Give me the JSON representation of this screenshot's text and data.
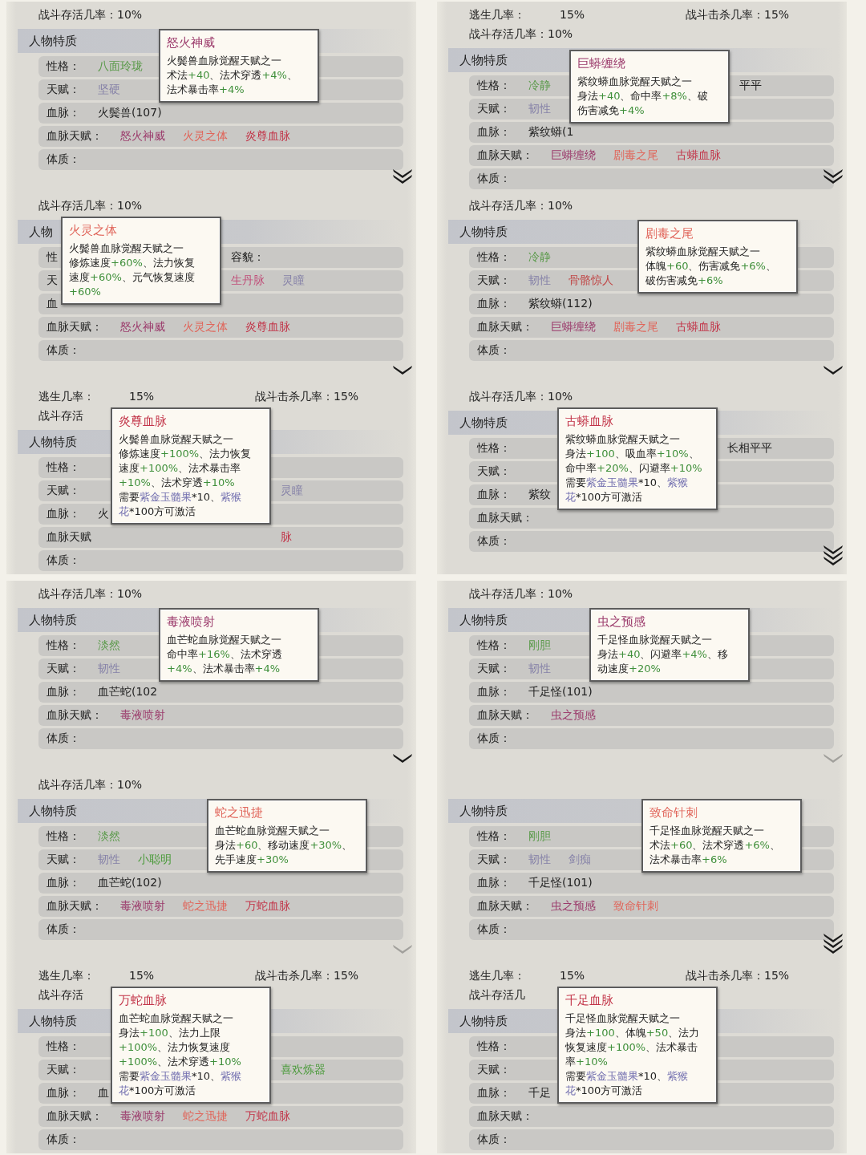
{
  "panels": [
    {
      "stat_lines": [
        [
          "战斗存活几率：10%"
        ]
      ],
      "section": "人物特质",
      "expand_icon": {
        "kind": "double"
      },
      "rows": [
        {
          "label": "性格：",
          "values": [
            {
              "text": "八面玲珑",
              "color": "#5a9a4a"
            }
          ]
        },
        {
          "label": "天赋：",
          "values": [
            {
              "text": "坚硬",
              "color": "#8682a8"
            }
          ]
        },
        {
          "label": "血脉：",
          "values": [
            {
              "text": "火鬓兽(107)",
              "color": "#222222"
            }
          ]
        },
        {
          "label": "血脉天赋：",
          "values": [
            {
              "text": "怒火神威",
              "color": "#9b3a6b"
            },
            {
              "text": "火灵之体",
              "color": "#e0655a"
            },
            {
              "text": "炎尊血脉",
              "color": "#c23448"
            }
          ]
        },
        {
          "label": "体质：",
          "values": []
        }
      ],
      "popup": {
        "title": "怒火神威",
        "color": "#9b3a6b",
        "lines": [
          [
            {
              "text": "火鬓兽血脉觉醒天赋之一",
              "kind": "plain"
            }
          ],
          [
            {
              "text": "术法",
              "kind": "plain"
            },
            {
              "text": "+40",
              "kind": "bonus"
            },
            {
              "text": "、法术穿透",
              "kind": "plain"
            },
            {
              "text": "+4%",
              "kind": "bonus"
            },
            {
              "text": "、",
              "kind": "plain"
            }
          ],
          [
            {
              "text": "法术暴击率",
              "kind": "plain"
            },
            {
              "text": "+4%",
              "kind": "bonus"
            }
          ]
        ]
      }
    },
    {
      "stat_lines": [
        [
          "战斗存活几率：10%"
        ]
      ],
      "section": "人物",
      "expand_icon": {
        "kind": "single"
      },
      "rows": [
        {
          "label": "性",
          "values": [],
          "beyond": [
            {
              "text": "容貌：",
              "color": "#222222"
            }
          ]
        },
        {
          "label": "天",
          "values": [],
          "beyond": [
            {
              "text": "生丹脉",
              "color": "#c0507a"
            },
            {
              "text": "灵瞳",
              "color": "#8682a8"
            }
          ]
        },
        {
          "label": "血",
          "values": []
        },
        {
          "label": "血脉天赋：",
          "values": [
            {
              "text": "怒火神威",
              "color": "#9b3a6b"
            },
            {
              "text": "火灵之体",
              "color": "#e0655a"
            },
            {
              "text": "炎尊血脉",
              "color": "#c23448"
            }
          ]
        },
        {
          "label": "体质：",
          "values": []
        }
      ],
      "popup": {
        "title": "火灵之体",
        "color": "#e0655a",
        "lines": [
          [
            {
              "text": "火鬓兽血脉觉醒天赋之一",
              "kind": "plain"
            }
          ],
          [
            {
              "text": "修炼速度",
              "kind": "plain"
            },
            {
              "text": "+60%",
              "kind": "bonus"
            },
            {
              "text": "、法力恢复",
              "kind": "plain"
            }
          ],
          [
            {
              "text": "速度",
              "kind": "plain"
            },
            {
              "text": "+60%",
              "kind": "bonus"
            },
            {
              "text": "、元气恢复速度",
              "kind": "plain"
            }
          ],
          [
            {
              "text": "+60%",
              "kind": "bonus"
            }
          ]
        ]
      }
    },
    {
      "stat_lines": [
        [
          "逃生几率：",
          "15%",
          "战斗击杀几率：15%"
        ],
        [
          "战斗存活"
        ]
      ],
      "section": "人物特质",
      "rows": [
        {
          "label": "性格：",
          "values": []
        },
        {
          "label": "天赋：",
          "values": [],
          "beyond": [
            {
              "text": "灵瞳",
              "color": "#8682a8"
            }
          ]
        },
        {
          "label": "血脉：",
          "values": [
            {
              "text": "火",
              "color": "#222222"
            }
          ]
        },
        {
          "label": "血脉天赋",
          "values": [],
          "beyond": [
            {
              "text": "脉",
              "color": "#c23448"
            }
          ]
        },
        {
          "label": "体质：",
          "values": []
        }
      ],
      "popup": {
        "title": "炎尊血脉",
        "color": "#c23448",
        "lines": [
          [
            {
              "text": "火鬓兽血脉觉醒天赋之一",
              "kind": "plain"
            }
          ],
          [
            {
              "text": "修炼速度",
              "kind": "plain"
            },
            {
              "text": "+100%",
              "kind": "bonus"
            },
            {
              "text": "、法力恢复",
              "kind": "plain"
            }
          ],
          [
            {
              "text": "速度",
              "kind": "plain"
            },
            {
              "text": "+100%",
              "kind": "bonus"
            },
            {
              "text": "、法术暴击率",
              "kind": "plain"
            }
          ],
          [
            {
              "text": "+10%",
              "kind": "bonus"
            },
            {
              "text": "、法术穿透",
              "kind": "plain"
            },
            {
              "text": "+10%",
              "kind": "bonus"
            }
          ],
          [
            {
              "text": "需要",
              "kind": "plain"
            },
            {
              "text": "紫金玉髓果",
              "kind": "item"
            },
            {
              "text": "*10、",
              "kind": "plain"
            },
            {
              "text": "紫猴",
              "kind": "item"
            }
          ],
          [
            {
              "text": "花",
              "kind": "item"
            },
            {
              "text": "*100方可激活",
              "kind": "plain"
            }
          ]
        ]
      }
    },
    {
      "stat_lines": [
        [
          "战斗存活几率：10%"
        ]
      ],
      "section": "人物特质",
      "expand_icon": {
        "kind": "single"
      },
      "rows": [
        {
          "label": "性格：",
          "values": [
            {
              "text": "淡然",
              "color": "#5a9a4a"
            }
          ]
        },
        {
          "label": "天赋：",
          "values": [
            {
              "text": "韧性",
              "color": "#8682a8"
            }
          ]
        },
        {
          "label": "血脉：",
          "values": [
            {
              "text": "血芒蛇(102",
              "color": "#222222"
            }
          ]
        },
        {
          "label": "血脉天赋：",
          "values": [
            {
              "text": "毒液喷射",
              "color": "#9b3a6b"
            }
          ]
        },
        {
          "label": "体质：",
          "values": []
        }
      ],
      "popup": {
        "title": "毒液喷射",
        "color": "#9b3a6b",
        "lines": [
          [
            {
              "text": "血芒蛇血脉觉醒天赋之一",
              "kind": "plain"
            }
          ],
          [
            {
              "text": "命中率",
              "kind": "plain"
            },
            {
              "text": "+16%",
              "kind": "bonus"
            },
            {
              "text": "、法术穿透",
              "kind": "plain"
            }
          ],
          [
            {
              "text": "+4%",
              "kind": "bonus"
            },
            {
              "text": "、法术暴击率",
              "kind": "plain"
            },
            {
              "text": "+4%",
              "kind": "bonus"
            }
          ]
        ]
      }
    },
    {
      "stat_lines": [
        [
          "战斗存活几率：10%"
        ]
      ],
      "section": "人物特质",
      "expand_icon": {
        "kind": "faded"
      },
      "rows": [
        {
          "label": "性格：",
          "values": [
            {
              "text": "淡然",
              "color": "#5a9a4a"
            }
          ]
        },
        {
          "label": "天赋：",
          "values": [
            {
              "text": "韧性",
              "color": "#8682a8"
            },
            {
              "text": "小聪明",
              "color": "#4a9a3a"
            }
          ]
        },
        {
          "label": "血脉：",
          "values": [
            {
              "text": "血芒蛇(102)",
              "color": "#222222"
            }
          ]
        },
        {
          "label": "血脉天赋：",
          "values": [
            {
              "text": "毒液喷射",
              "color": "#9b3a6b"
            },
            {
              "text": "蛇之迅捷",
              "color": "#e0655a"
            },
            {
              "text": "万蛇血脉",
              "color": "#c23448"
            }
          ]
        },
        {
          "label": "体质：",
          "values": []
        }
      ],
      "popup": {
        "title": "蛇之迅捷",
        "color": "#e0655a",
        "lines": [
          [
            {
              "text": "血芒蛇血脉觉醒天赋之一",
              "kind": "plain"
            }
          ],
          [
            {
              "text": "身法",
              "kind": "plain"
            },
            {
              "text": "+60",
              "kind": "bonus"
            },
            {
              "text": "、移动速度",
              "kind": "plain"
            },
            {
              "text": "+30%",
              "kind": "bonus"
            },
            {
              "text": "、",
              "kind": "plain"
            }
          ],
          [
            {
              "text": "先手速度",
              "kind": "plain"
            },
            {
              "text": "+30%",
              "kind": "bonus"
            }
          ]
        ]
      }
    },
    {
      "stat_lines": [
        [
          "逃生几率：",
          "15%",
          "战斗击杀几率：15%"
        ],
        [
          "战斗存活"
        ]
      ],
      "section": "人物特质",
      "rows": [
        {
          "label": "性格：",
          "values": []
        },
        {
          "label": "天赋：",
          "values": [],
          "beyond": [
            {
              "text": "喜欢炼器",
              "color": "#4a9a3a"
            }
          ]
        },
        {
          "label": "血脉：",
          "values": [
            {
              "text": "血",
              "color": "#222222"
            }
          ]
        },
        {
          "label": "血脉天赋：",
          "values": [
            {
              "text": "毒液喷射",
              "color": "#9b3a6b"
            },
            {
              "text": "蛇之迅捷",
              "color": "#e0655a"
            },
            {
              "text": "万蛇血脉",
              "color": "#c23448"
            }
          ]
        },
        {
          "label": "体质：",
          "values": []
        }
      ],
      "popup": {
        "title": "万蛇血脉",
        "color": "#c23448",
        "lines": [
          [
            {
              "text": "血芒蛇血脉觉醒天赋之一",
              "kind": "plain"
            }
          ],
          [
            {
              "text": "身法",
              "kind": "plain"
            },
            {
              "text": "+100",
              "kind": "bonus"
            },
            {
              "text": "、法力上限",
              "kind": "plain"
            }
          ],
          [
            {
              "text": "+100%",
              "kind": "bonus"
            },
            {
              "text": "、法力恢复速度",
              "kind": "plain"
            }
          ],
          [
            {
              "text": "+100%",
              "kind": "bonus"
            },
            {
              "text": "、法术穿透",
              "kind": "plain"
            },
            {
              "text": "+10%",
              "kind": "bonus"
            }
          ],
          [
            {
              "text": "需要",
              "kind": "plain"
            },
            {
              "text": "紫金玉髓果",
              "kind": "item"
            },
            {
              "text": "*10、",
              "kind": "plain"
            },
            {
              "text": "紫猴",
              "kind": "item"
            }
          ],
          [
            {
              "text": "花",
              "kind": "item"
            },
            {
              "text": "*100方可激活",
              "kind": "plain"
            }
          ]
        ]
      }
    },
    {
      "stat_lines": [
        [
          "逃生几率：",
          "15%",
          "战斗击杀几率：15%"
        ],
        [
          "战斗存活几率：10%"
        ]
      ],
      "section": "人物特质",
      "expand_icon": {
        "kind": "double"
      },
      "rows": [
        {
          "label": "性格：",
          "values": [
            {
              "text": "冷静",
              "color": "#5a9a4a"
            }
          ],
          "beyond": [
            {
              "text": "平平",
              "color": "#222222"
            }
          ]
        },
        {
          "label": "天赋：",
          "values": [
            {
              "text": "韧性",
              "color": "#8682a8"
            }
          ]
        },
        {
          "label": "血脉：",
          "values": [
            {
              "text": "紫纹蟒(1",
              "color": "#222222"
            }
          ]
        },
        {
          "label": "血脉天赋：",
          "values": [
            {
              "text": "巨蟒缠绕",
              "color": "#9b3a6b"
            },
            {
              "text": "剧毒之尾",
              "color": "#e0655a"
            },
            {
              "text": "古蟒血脉",
              "color": "#c23448"
            }
          ]
        },
        {
          "label": "体质：",
          "values": []
        }
      ],
      "popup": {
        "title": "巨蟒缠绕",
        "color": "#9b3a6b",
        "lines": [
          [
            {
              "text": "紫纹蟒血脉觉醒天赋之一",
              "kind": "plain"
            }
          ],
          [
            {
              "text": "身法",
              "kind": "plain"
            },
            {
              "text": "+40",
              "kind": "bonus"
            },
            {
              "text": "、命中率",
              "kind": "plain"
            },
            {
              "text": "+8%",
              "kind": "bonus"
            },
            {
              "text": "、破",
              "kind": "plain"
            }
          ],
          [
            {
              "text": "伤害减免",
              "kind": "plain"
            },
            {
              "text": "+4%",
              "kind": "bonus"
            }
          ]
        ]
      }
    },
    {
      "stat_lines": [
        [
          "战斗存活几率：10%"
        ]
      ],
      "section": "人物特质",
      "expand_icon": {
        "kind": "single"
      },
      "rows": [
        {
          "label": "性格：",
          "values": [
            {
              "text": "冷静",
              "color": "#5a9a4a"
            }
          ]
        },
        {
          "label": "天赋：",
          "values": [
            {
              "text": "韧性",
              "color": "#8682a8"
            },
            {
              "text": "骨骼惊人",
              "color": "#c04848"
            }
          ]
        },
        {
          "label": "血脉：",
          "values": [
            {
              "text": "紫纹蟒(112)",
              "color": "#222222"
            }
          ]
        },
        {
          "label": "血脉天赋：",
          "values": [
            {
              "text": "巨蟒缠绕",
              "color": "#9b3a6b"
            },
            {
              "text": "剧毒之尾",
              "color": "#e0655a"
            },
            {
              "text": "古蟒血脉",
              "color": "#c23448"
            }
          ]
        },
        {
          "label": "体质：",
          "values": []
        }
      ],
      "popup": {
        "title": "剧毒之尾",
        "color": "#e0655a",
        "lines": [
          [
            {
              "text": "紫纹蟒血脉觉醒天赋之一",
              "kind": "plain"
            }
          ],
          [
            {
              "text": "体魄",
              "kind": "plain"
            },
            {
              "text": "+60",
              "kind": "bonus"
            },
            {
              "text": "、伤害减免",
              "kind": "plain"
            },
            {
              "text": "+6%",
              "kind": "bonus"
            },
            {
              "text": "、",
              "kind": "plain"
            }
          ],
          [
            {
              "text": "破伤害减免",
              "kind": "plain"
            },
            {
              "text": "+6%",
              "kind": "bonus"
            }
          ]
        ]
      }
    },
    {
      "stat_lines": [
        [
          "战斗存活几率：10%"
        ]
      ],
      "section": "人物特质",
      "expand_icon": {
        "kind": "triple"
      },
      "rows": [
        {
          "label": "性格：",
          "values": [],
          "beyond": [
            {
              "text": "长相平平",
              "color": "#222222"
            }
          ]
        },
        {
          "label": "天赋：",
          "values": []
        },
        {
          "label": "血脉：",
          "values": [
            {
              "text": "紫纹",
              "color": "#222222"
            }
          ]
        },
        {
          "label": "血脉天赋：",
          "values": []
        },
        {
          "label": "体质：",
          "values": []
        }
      ],
      "popup": {
        "title": "古蟒血脉",
        "color": "#c23448",
        "lines": [
          [
            {
              "text": "紫纹蟒血脉觉醒天赋之一",
              "kind": "plain"
            }
          ],
          [
            {
              "text": "身法",
              "kind": "plain"
            },
            {
              "text": "+100",
              "kind": "bonus"
            },
            {
              "text": "、吸血率",
              "kind": "plain"
            },
            {
              "text": "+10%",
              "kind": "bonus"
            },
            {
              "text": "、",
              "kind": "plain"
            }
          ],
          [
            {
              "text": "命中率",
              "kind": "plain"
            },
            {
              "text": "+20%",
              "kind": "bonus"
            },
            {
              "text": "、闪避率",
              "kind": "plain"
            },
            {
              "text": "+10%",
              "kind": "bonus"
            }
          ],
          [
            {
              "text": "需要",
              "kind": "plain"
            },
            {
              "text": "紫金玉髓果",
              "kind": "item"
            },
            {
              "text": "*10、",
              "kind": "plain"
            },
            {
              "text": "紫猴",
              "kind": "item"
            }
          ],
          [
            {
              "text": "花",
              "kind": "item"
            },
            {
              "text": "*100方可激活",
              "kind": "plain"
            }
          ]
        ]
      }
    },
    {
      "stat_lines": [
        [
          "战斗存活几率：10%"
        ]
      ],
      "section": "人物特质",
      "expand_icon": {
        "kind": "faded"
      },
      "rows": [
        {
          "label": "性格：",
          "values": [
            {
              "text": "刚胆",
              "color": "#5a9a4a"
            }
          ]
        },
        {
          "label": "天赋：",
          "values": [
            {
              "text": "韧性",
              "color": "#8682a8"
            }
          ]
        },
        {
          "label": "血脉：",
          "values": [
            {
              "text": "千足怪(101)",
              "color": "#222222"
            }
          ]
        },
        {
          "label": "血脉天赋：",
          "values": [
            {
              "text": "虫之预感",
              "color": "#9b3a6b"
            }
          ]
        },
        {
          "label": "体质：",
          "values": []
        }
      ],
      "popup": {
        "title": "虫之预感",
        "color": "#9b3a6b",
        "lines": [
          [
            {
              "text": "千足怪血脉觉醒天赋之一",
              "kind": "plain"
            }
          ],
          [
            {
              "text": "身法",
              "kind": "plain"
            },
            {
              "text": "+40",
              "kind": "bonus"
            },
            {
              "text": "、闪避率",
              "kind": "plain"
            },
            {
              "text": "+4%",
              "kind": "bonus"
            },
            {
              "text": "、移",
              "kind": "plain"
            }
          ],
          [
            {
              "text": "动速度",
              "kind": "plain"
            },
            {
              "text": "+20%",
              "kind": "bonus"
            }
          ]
        ]
      }
    },
    {
      "section": "人物特质",
      "expand_icon": {
        "kind": "triple"
      },
      "rows": [
        {
          "label": "性格：",
          "values": [
            {
              "text": "刚胆",
              "color": "#5a9a4a"
            }
          ]
        },
        {
          "label": "天赋：",
          "values": [
            {
              "text": "韧性",
              "color": "#8682a8"
            },
            {
              "text": "剑痴",
              "color": "#8682a8"
            }
          ]
        },
        {
          "label": "血脉：",
          "values": [
            {
              "text": "千足怪(101)",
              "color": "#222222"
            }
          ]
        },
        {
          "label": "血脉天赋：",
          "values": [
            {
              "text": "虫之预感",
              "color": "#9b3a6b"
            },
            {
              "text": "致命针刺",
              "color": "#e0655a"
            }
          ]
        },
        {
          "label": "体质：",
          "values": []
        }
      ],
      "popup": {
        "title": "致命针刺",
        "color": "#e0655a",
        "lines": [
          [
            {
              "text": "千足怪血脉觉醒天赋之一",
              "kind": "plain"
            }
          ],
          [
            {
              "text": "术法",
              "kind": "plain"
            },
            {
              "text": "+60",
              "kind": "bonus"
            },
            {
              "text": "、法术穿透",
              "kind": "plain"
            },
            {
              "text": "+6%",
              "kind": "bonus"
            },
            {
              "text": "、",
              "kind": "plain"
            }
          ],
          [
            {
              "text": "法术暴击率",
              "kind": "plain"
            },
            {
              "text": "+6%",
              "kind": "bonus"
            }
          ]
        ]
      }
    },
    {
      "stat_lines": [
        [
          "逃生几率：",
          "15%",
          "战斗击杀几率：15%"
        ],
        [
          "战斗存活几"
        ]
      ],
      "section": "人物特质",
      "rows": [
        {
          "label": "性格：",
          "values": []
        },
        {
          "label": "天赋：",
          "values": []
        },
        {
          "label": "血脉：",
          "values": [
            {
              "text": "千足",
              "color": "#222222"
            }
          ]
        },
        {
          "label": "血脉天赋：",
          "values": []
        },
        {
          "label": "体质：",
          "values": []
        }
      ],
      "popup": {
        "title": "千足血脉",
        "color": "#c23448",
        "lines": [
          [
            {
              "text": "千足怪血脉觉醒天赋之一",
              "kind": "plain"
            }
          ],
          [
            {
              "text": "身法",
              "kind": "plain"
            },
            {
              "text": "+100",
              "kind": "bonus"
            },
            {
              "text": "、体魄",
              "kind": "plain"
            },
            {
              "text": "+50",
              "kind": "bonus"
            },
            {
              "text": "、法力",
              "kind": "plain"
            }
          ],
          [
            {
              "text": "恢复速度",
              "kind": "plain"
            },
            {
              "text": "+100%",
              "kind": "bonus"
            },
            {
              "text": "、法术暴击",
              "kind": "plain"
            }
          ],
          [
            {
              "text": "率",
              "kind": "plain"
            },
            {
              "text": "+10%",
              "kind": "bonus"
            }
          ],
          [
            {
              "text": "需要",
              "kind": "plain"
            },
            {
              "text": "紫金玉髓果",
              "kind": "item"
            },
            {
              "text": "*10、",
              "kind": "plain"
            },
            {
              "text": "紫猴",
              "kind": "item"
            }
          ],
          [
            {
              "text": "花",
              "kind": "item"
            },
            {
              "text": "*100方可激活",
              "kind": "plain"
            }
          ]
        ]
      }
    }
  ]
}
